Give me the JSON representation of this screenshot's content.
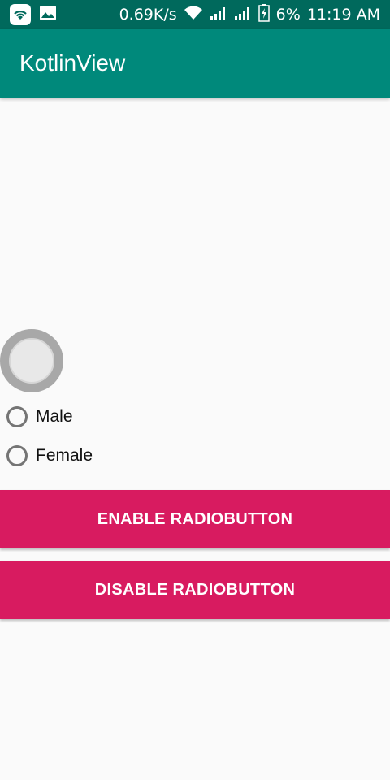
{
  "status_bar": {
    "net_speed": "0.69K/s",
    "battery": "6%",
    "time": "11:19 AM",
    "icons": [
      "wifi-app-icon",
      "image-icon",
      "wifi-icon",
      "signal-icon",
      "signal-icon",
      "battery-icon"
    ]
  },
  "app_bar": {
    "title": "KotlinView"
  },
  "radio_group": {
    "options": [
      {
        "label": "Male",
        "checked": false
      },
      {
        "label": "Female",
        "checked": false
      }
    ]
  },
  "buttons": {
    "enable_label": "ENABLE RADIOBUTTON",
    "disable_label": "DISABLE RADIOBUTTON"
  },
  "colors": {
    "status_bar": "#00695c",
    "app_bar": "#00897b",
    "button": "#d81b60",
    "background": "#fafafa"
  }
}
